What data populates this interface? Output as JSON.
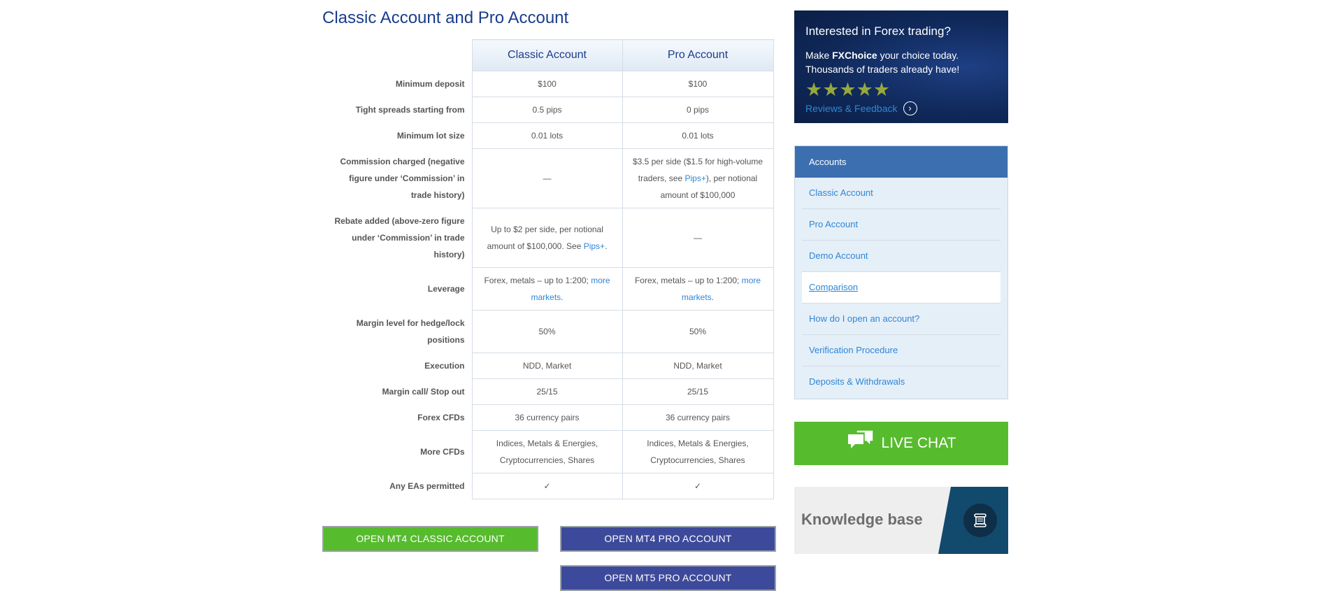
{
  "page_title": "Classic Account and Pro Account",
  "table": {
    "headers": [
      "Classic Account",
      "Pro Account"
    ],
    "rows": [
      {
        "label": "Minimum deposit",
        "classic": "$100",
        "pro": "$100"
      },
      {
        "label": "Tight spreads starting from",
        "classic": "0.5 pips",
        "pro": "0 pips"
      },
      {
        "label": "Minimum lot size",
        "classic": "0.01 lots",
        "pro": "0.01 lots"
      },
      {
        "label": "Commission charged (negative figure under ‘Commission’ in trade history)",
        "classic": "—",
        "pro_pre": "$3.5 per side ($1.5 for high-volume traders, see ",
        "pro_link": "Pips+",
        "pro_post": "), per notional amount of $100,000"
      },
      {
        "label": "Rebate added (above-zero figure under ‘Commission’ in trade history)",
        "classic_pre": "Up to $2 per side, per notional amount of $100,000. See ",
        "classic_link": "Pips+",
        "classic_post": ".",
        "pro": "—"
      },
      {
        "label": "Leverage",
        "classic_pre": "Forex, metals – up to 1:200; ",
        "classic_link": "more markets",
        "classic_post": ".",
        "pro_pre": "Forex, metals – up to 1:200; ",
        "pro_link": "more markets",
        "pro_post": "."
      },
      {
        "label": "Margin level for hedge/lock positions",
        "classic": "50%",
        "pro": "50%"
      },
      {
        "label": "Execution",
        "classic": "NDD, Market",
        "pro": "NDD, Market"
      },
      {
        "label": "Margin call/ Stop out",
        "classic": "25/15",
        "pro": "25/15"
      },
      {
        "label": "Forex CFDs",
        "classic": "36 currency pairs",
        "pro": "36 currency pairs"
      },
      {
        "label": "More CFDs",
        "classic": "Indices, Metals & Energies, Cryptocurrencies, Shares",
        "pro": "Indices, Metals & Energies, Cryptocurrencies, Shares"
      },
      {
        "label": "Any EAs permitted",
        "classic": "✓",
        "pro": "✓"
      }
    ]
  },
  "buttons": {
    "mt4_classic": "OPEN MT4 CLASSIC ACCOUNT",
    "mt4_pro": "OPEN MT4 PRO ACCOUNT",
    "mt5_pro": "OPEN MT5 PRO ACCOUNT"
  },
  "promo": {
    "heading": "Interested in Forex trading?",
    "line1_pre": "Make ",
    "brand": "FXChoice",
    "line1_post": " your choice today.",
    "line2": "Thousands of traders already have!",
    "stars": "★★★★★",
    "reviews_link": "Reviews & Feedback"
  },
  "accounts_menu": {
    "title": "Accounts",
    "items": [
      "Classic Account",
      "Pro Account",
      "Demo Account",
      "Comparison",
      "How do I open an account?",
      "Verification Procedure",
      "Deposits & Withdrawals"
    ],
    "active_index": 3
  },
  "live_chat": "LIVE CHAT",
  "knowledge_base": "Knowledge base",
  "colors": {
    "accent_green": "#57bb2e",
    "accent_blue": "#3d4a9b",
    "link": "#2f86d6",
    "title": "#1a3c8c"
  }
}
